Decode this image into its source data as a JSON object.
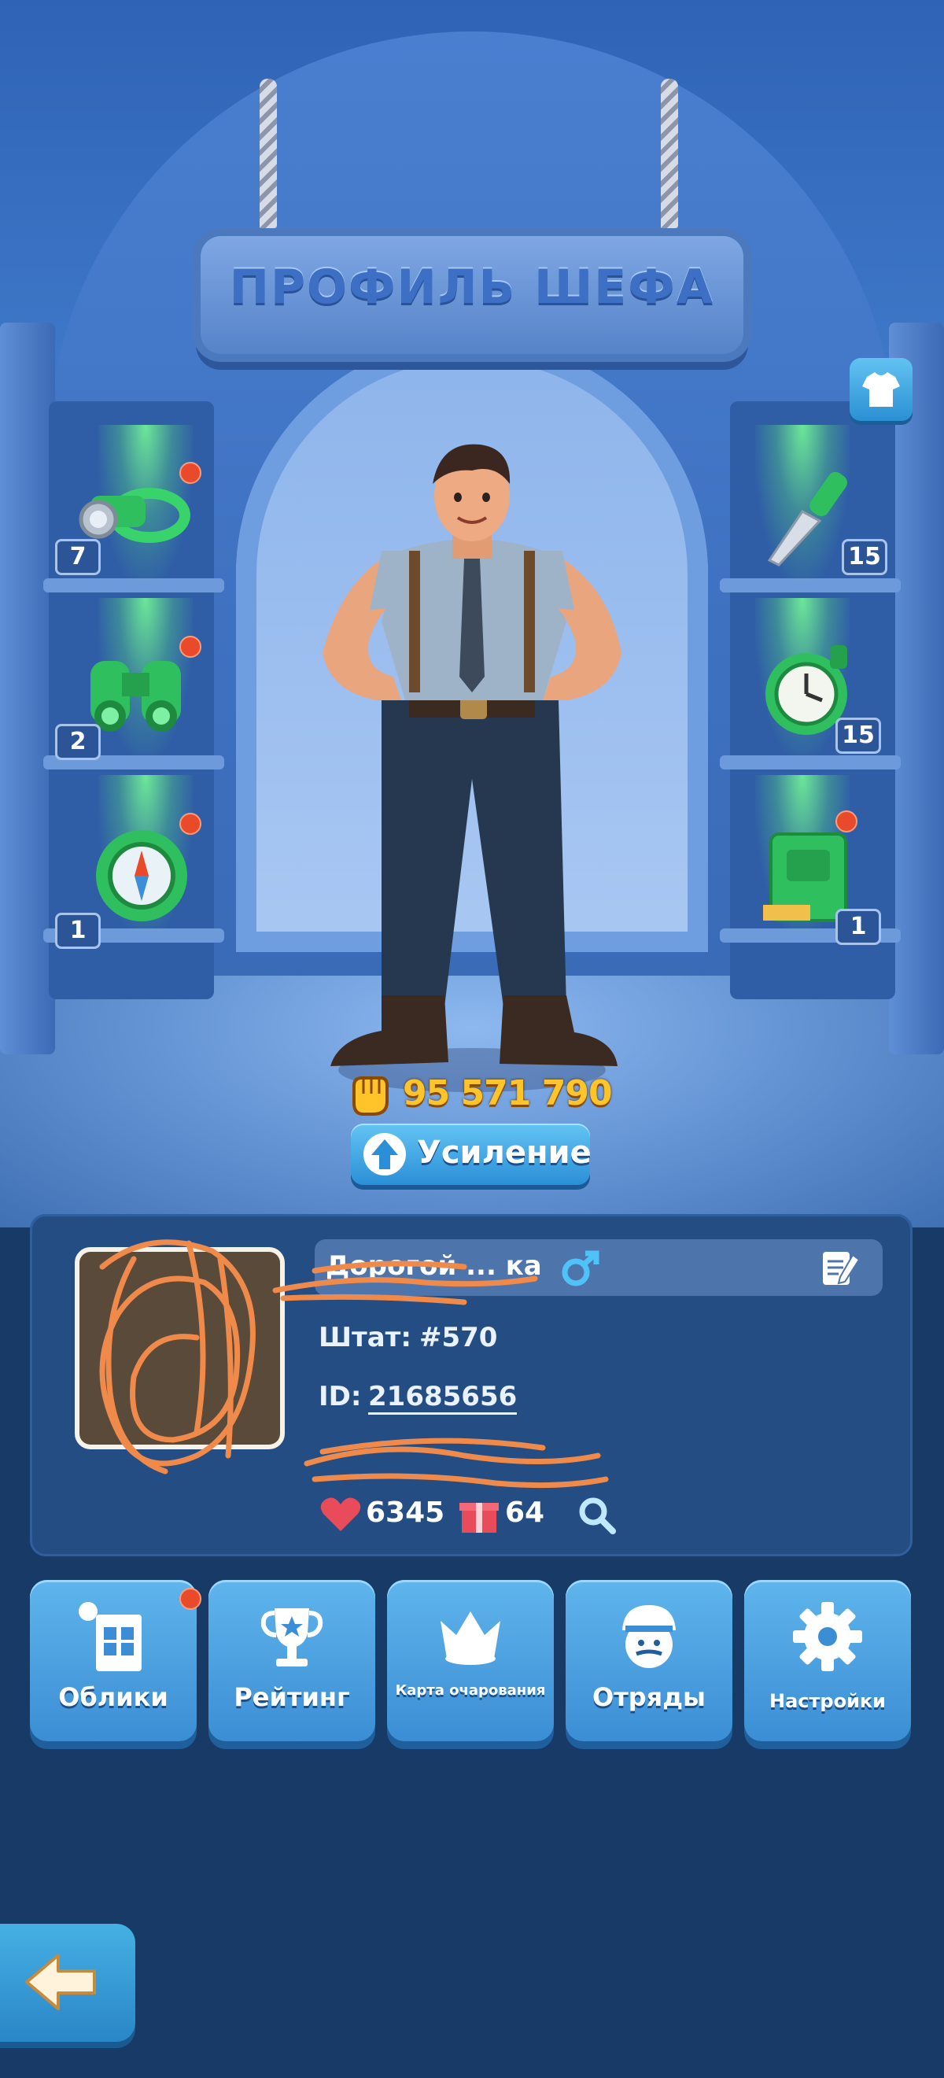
{
  "header": {
    "title": "ПРОФИЛЬ ШЕФА"
  },
  "equipment": {
    "left": [
      {
        "name": "headlamp",
        "count": "7",
        "alert": true
      },
      {
        "name": "binoculars",
        "count": "2",
        "alert": true
      },
      {
        "name": "compass",
        "count": "1",
        "alert": true
      }
    ],
    "right": [
      {
        "name": "knife",
        "count": "15",
        "alert": false
      },
      {
        "name": "stopwatch",
        "count": "15",
        "alert": false
      },
      {
        "name": "notebook",
        "count": "1",
        "alert": true
      }
    ]
  },
  "character": {
    "power": "95 571 790",
    "boost_label": "Усиление"
  },
  "profile": {
    "name": "Дорогой ... ка",
    "staff_label": "Штат:",
    "staff_value": "#570",
    "id_label": "ID:",
    "id_value": "21685656",
    "likes": "6345",
    "gifts": "64"
  },
  "menu": [
    {
      "label": "Облики",
      "icon": "wardrobe-icon",
      "alert": true
    },
    {
      "label": "Рейтинг",
      "icon": "trophy-icon",
      "alert": false
    },
    {
      "label": "Карта очарования",
      "icon": "crown-icon",
      "alert": false
    },
    {
      "label": "Отряды",
      "icon": "squad-icon",
      "alert": false
    },
    {
      "label": "Настройки",
      "icon": "gear-icon",
      "alert": false
    }
  ],
  "colors": {
    "background": "#183a67",
    "button": "#3b8ed4",
    "alert": "#e84a2a",
    "power": "#ffc42a",
    "gender": "#4fc3f7",
    "scribble": "#f08a4b"
  }
}
